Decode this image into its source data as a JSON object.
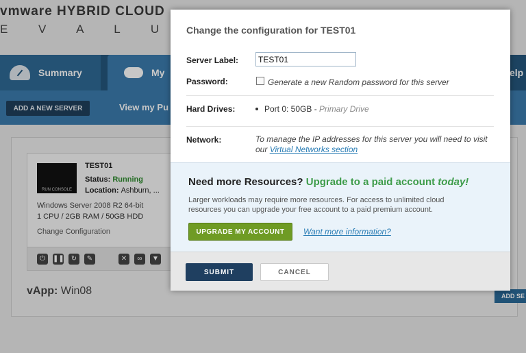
{
  "app": {
    "brand_title": "vmware HYBRID CLOUD",
    "brand_sub": "E V A L U A T I O N"
  },
  "nav": {
    "summary": "Summary",
    "my": "My",
    "help": "elp",
    "add_server": "ADD A NEW SERVER",
    "view_my": "View my Pu"
  },
  "server_card": {
    "console_label": "RUN CONSOLE",
    "name": "TEST01",
    "status_label": "Status:",
    "status_value": "Running",
    "location_label": "Location:",
    "location_value": "Ashburn, ...",
    "os": "Windows Server 2008 R2 64-bit",
    "spec": "1 CPU / 2GB RAM / 50GB HDD",
    "change": "Change Configuration"
  },
  "vapp": {
    "label": "vApp:",
    "value": "Win08"
  },
  "add_se": "ADD SE",
  "modal": {
    "title": "Change the configuration for TEST01",
    "server_label_label": "Server Label:",
    "server_label_value": "TEST01",
    "password_label": "Password:",
    "password_text": "Generate a new Random password for this server",
    "hard_drives_label": "Hard Drives:",
    "hard_drive_text": "Port 0: 50GB -",
    "hard_drive_primary": "Primary Drive",
    "network_label": "Network:",
    "network_text": "To manage the IP addresses for this server you will need to visit our",
    "network_link": "Virtual Networks section",
    "promo_title": "Need more Resources?",
    "promo_green": "Upgrade to a paid account",
    "promo_today": "today!",
    "promo_text": "Larger workloads may require more resources. For access to unlimited cloud resources you can upgrade your free account to a paid premium account.",
    "upgrade_button": "UPGRADE MY ACCOUNT",
    "more_info_link": "Want more information?",
    "submit_button": "SUBMIT",
    "cancel_button": "CANCEL"
  },
  "colors": {
    "nav_dark": "#24577d",
    "nav_light": "#3b7bad",
    "upgrade_green": "#6f9b24",
    "submit_navy": "#1f3f60",
    "link_blue": "#2a7db5",
    "running_green": "#2e8b2e"
  }
}
